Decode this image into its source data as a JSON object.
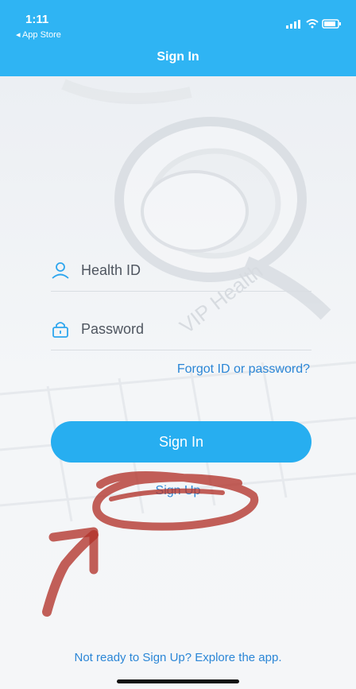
{
  "status_bar": {
    "time": "1:11",
    "back_link": "◂ App Store"
  },
  "header": {
    "title": "Sign In"
  },
  "background": {
    "watermark_text": "VIP Health"
  },
  "form": {
    "health_id_placeholder": "Health ID",
    "password_placeholder": "Password",
    "forgot_link": "Forgot ID or password?",
    "sign_in_label": "Sign In",
    "sign_up_label": "Sign Up",
    "explore_link": "Not ready to Sign Up? Explore the app."
  },
  "colors": {
    "header_bg": "#2fb4f3",
    "accent": "#27aef0",
    "link": "#2b86d6",
    "annotation": "#b2332a"
  },
  "icons": [
    "signal-icon",
    "wifi-icon",
    "battery-icon",
    "user-icon",
    "lock-icon"
  ]
}
